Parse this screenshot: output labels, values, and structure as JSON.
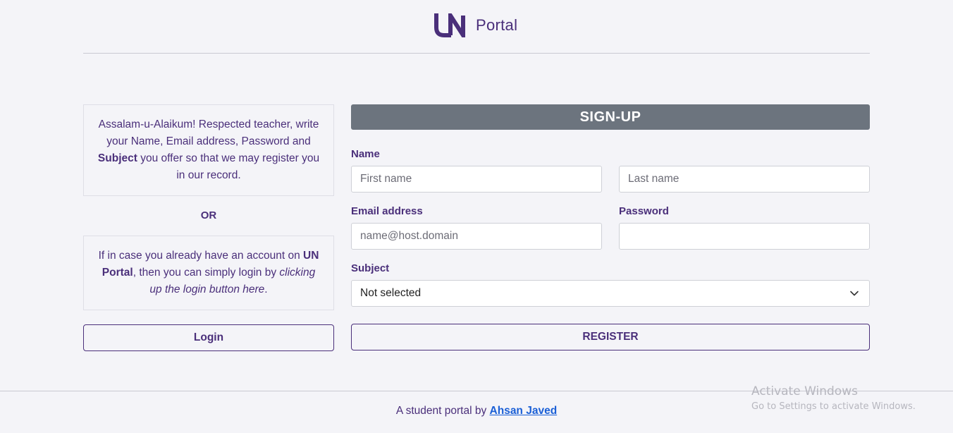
{
  "header": {
    "logo_mark": "UN",
    "logo_text": "Portal"
  },
  "left_panel": {
    "intro_parts": [
      "Assalam-u-Alaikum! Respected teacher, write your Name, Email address, Password and ",
      "Subject",
      " you offer so that we may register you in our record."
    ],
    "or_label": "OR",
    "login_hint_parts": [
      "If in case you already have an account on ",
      "UN Portal",
      ", then you can simply login by ",
      "clicking up the login button here",
      "."
    ],
    "login_button": "Login"
  },
  "form": {
    "title": "SIGN-UP",
    "name_label": "Name",
    "first_name_placeholder": "First name",
    "last_name_placeholder": "Last name",
    "email_label": "Email address",
    "email_placeholder": "name@host.domain",
    "password_label": "Password",
    "password_value": "",
    "subject_label": "Subject",
    "subject_selected": "Not selected",
    "register_button": "REGISTER"
  },
  "footer": {
    "text": "A student portal by ",
    "author_link": "Ahsan Javed"
  },
  "watermark": {
    "title": "Activate Windows",
    "subtitle": "Go to Settings to activate Windows."
  },
  "colors": {
    "accent": "#4a2f7a",
    "banner": "#6c747e",
    "link": "#1a5fd6",
    "background": "#f4f4f8"
  }
}
